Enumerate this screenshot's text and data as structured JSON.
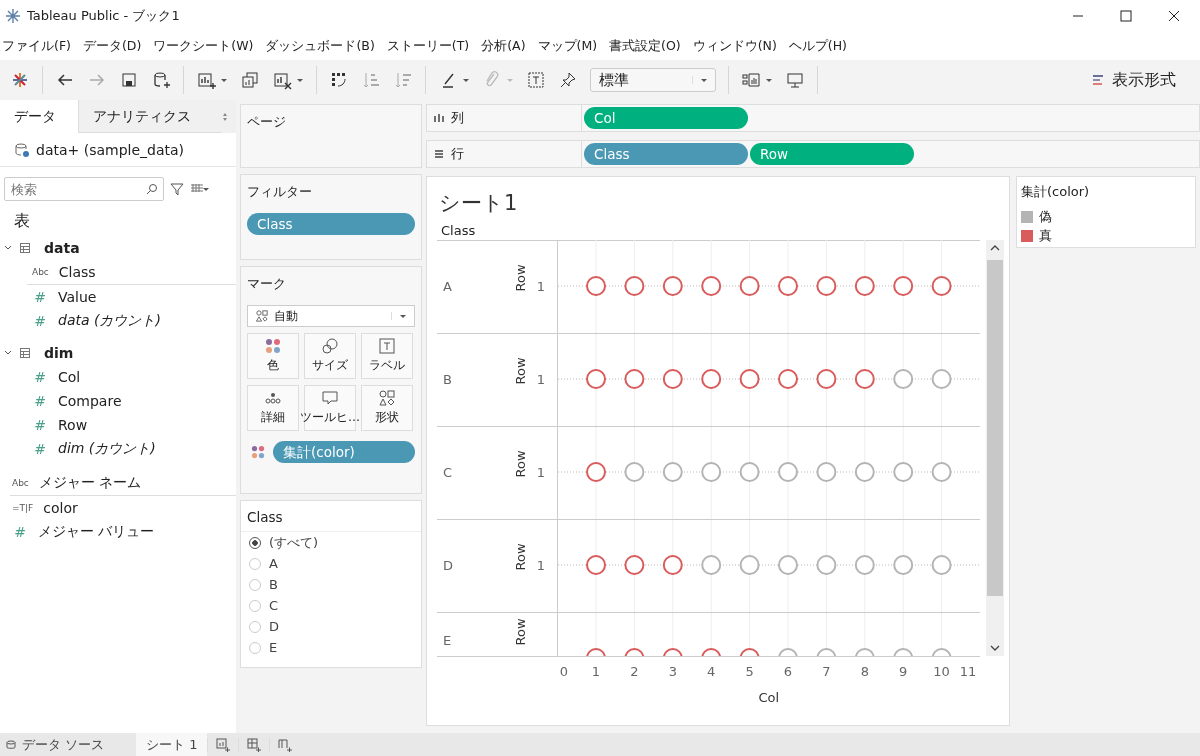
{
  "window": {
    "title": "Tableau Public - ブック1"
  },
  "menu": [
    "ファイル(F)",
    "データ(D)",
    "ワークシート(W)",
    "ダッシュボード(B)",
    "ストーリー(T)",
    "分析(A)",
    "マップ(M)",
    "書式設定(O)",
    "ウィンドウ(N)",
    "ヘルプ(H)"
  ],
  "toolbar": {
    "view_dropdown": "標準",
    "show_me": "表示形式"
  },
  "data_pane": {
    "tabs": [
      {
        "label": "データ",
        "selected": true
      },
      {
        "label": "アナリティクス",
        "selected": false
      }
    ],
    "data_source": "data+ (sample_data)",
    "search": {
      "placeholder": "検索"
    },
    "section": "表",
    "tables": [
      {
        "name": "data",
        "expanded": true,
        "children": [
          {
            "type_label": "Abc",
            "name": "Class",
            "italic": false,
            "divider_after": true
          },
          {
            "type_label": "#",
            "name": "Value",
            "italic": false,
            "divider_after": false
          },
          {
            "type_label": "#",
            "name": "data (カウント)",
            "italic": true,
            "divider_after": false
          }
        ]
      },
      {
        "name": "dim",
        "expanded": true,
        "children": [
          {
            "type_label": "#",
            "name": "Col",
            "italic": false,
            "divider_after": false
          },
          {
            "type_label": "#",
            "name": "Compare",
            "italic": false,
            "divider_after": false
          },
          {
            "type_label": "#",
            "name": "Row",
            "italic": false,
            "divider_after": false
          },
          {
            "type_label": "#",
            "name": "dim (カウント)",
            "italic": true,
            "divider_after": false
          }
        ]
      }
    ],
    "extra_fields": [
      {
        "type_label": "Abc",
        "name": "メジャー ネーム",
        "divider_after": true
      },
      {
        "type_label": "=T|F",
        "name": "color",
        "divider_after": false
      },
      {
        "type_label": "#",
        "name": "メジャー バリュー",
        "divider_after": false
      }
    ]
  },
  "pages": {
    "title": "ページ"
  },
  "filters": {
    "title": "フィルター",
    "pills": [
      {
        "label": "Class",
        "kind": "discrete"
      }
    ]
  },
  "marks": {
    "title": "マーク",
    "type": "自動",
    "buttons": [
      {
        "kind": "color",
        "label": "色"
      },
      {
        "kind": "size",
        "label": "サイズ"
      },
      {
        "kind": "label",
        "label": "ラベル"
      },
      {
        "kind": "detail",
        "label": "詳細"
      },
      {
        "kind": "tooltip",
        "label": "ツールヒ…"
      },
      {
        "kind": "shape",
        "label": "形状"
      }
    ],
    "pills": [
      {
        "label": "集計(color)",
        "kind": "discrete"
      }
    ]
  },
  "quick_filter": {
    "title": "Class",
    "options": [
      {
        "label": "(すべて)",
        "selected": true
      },
      {
        "label": "A",
        "selected": false
      },
      {
        "label": "B",
        "selected": false
      },
      {
        "label": "C",
        "selected": false
      },
      {
        "label": "D",
        "selected": false
      },
      {
        "label": "E",
        "selected": false
      }
    ]
  },
  "columns_shelf": {
    "label": "列",
    "pills": [
      {
        "label": "Col",
        "kind": "continuous"
      }
    ]
  },
  "rows_shelf": {
    "label": "行",
    "pills": [
      {
        "label": "Class",
        "kind": "discrete"
      },
      {
        "label": "Row",
        "kind": "continuous"
      }
    ]
  },
  "worksheet": {
    "title": "シート1",
    "header": "Class",
    "axis_title": "Col",
    "x_ticks": [
      "0",
      "1",
      "2",
      "3",
      "4",
      "5",
      "6",
      "7",
      "8",
      "9",
      "10",
      "11"
    ],
    "panes": [
      {
        "class": "A",
        "row_axis": "Row",
        "row_tick": "1",
        "marks": [
          true,
          true,
          true,
          true,
          true,
          true,
          true,
          true,
          true,
          true
        ]
      },
      {
        "class": "B",
        "row_axis": "Row",
        "row_tick": "1",
        "marks": [
          true,
          true,
          true,
          true,
          true,
          true,
          true,
          true,
          false,
          false
        ]
      },
      {
        "class": "C",
        "row_axis": "Row",
        "row_tick": "1",
        "marks": [
          true,
          false,
          false,
          false,
          false,
          false,
          false,
          false,
          false,
          false
        ]
      },
      {
        "class": "D",
        "row_axis": "Row",
        "row_tick": "1",
        "marks": [
          true,
          true,
          true,
          false,
          false,
          false,
          false,
          false,
          false,
          false
        ]
      },
      {
        "class": "E",
        "row_axis": "Row",
        "marks": [
          true,
          true,
          true,
          true,
          true,
          false,
          false,
          false,
          false,
          false
        ]
      }
    ]
  },
  "legend": {
    "title": "集計(color)",
    "items": [
      {
        "label": "偽",
        "color": "#b4b4b4"
      },
      {
        "label": "真",
        "color": "#d95b5b"
      }
    ]
  },
  "bottom_tabs": {
    "data_source": "データ ソース",
    "sheets": [
      {
        "label": "シート 1",
        "selected": true
      }
    ]
  }
}
